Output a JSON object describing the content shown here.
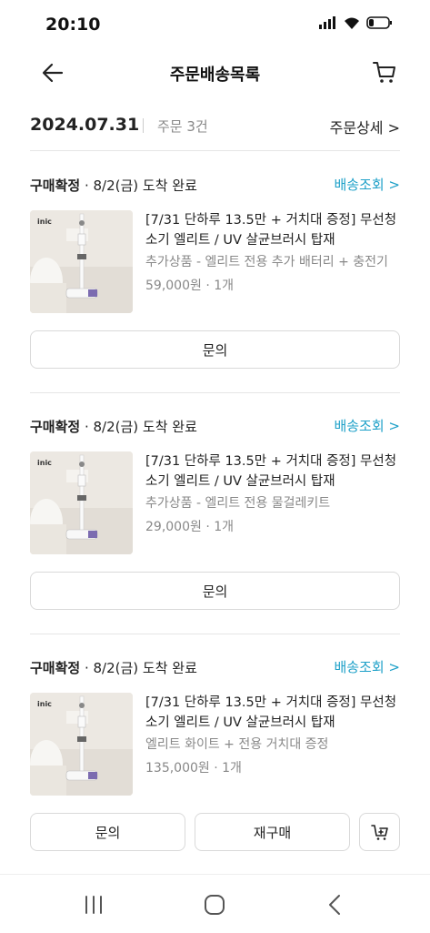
{
  "status_bar": {
    "time": "20:10"
  },
  "header": {
    "title": "주문배송목록"
  },
  "summary": {
    "date": "2024.07.31",
    "count": "주문 3건",
    "detail_link": "주문상세 >"
  },
  "orders": [
    {
      "status_bold": "구매확정",
      "status_rest": " · 8/2(금) 도착 완료",
      "track_label": "배송조회 >",
      "thumb_brand": "inic",
      "title": "[7/31 단하루 13.5만 + 거치대 증정] 무선청소기 엘리트 / UV 살균브러시 탑재",
      "option": "추가상품 - 엘리트 전용 추가 배터리 + 충전기",
      "price": "59,000원 · 1개",
      "buttons": [
        "문의"
      ]
    },
    {
      "status_bold": "구매확정",
      "status_rest": " · 8/2(금) 도착 완료",
      "track_label": "배송조회 >",
      "thumb_brand": "inic",
      "title": "[7/31 단하루 13.5만 + 거치대 증정] 무선청소기 엘리트 / UV 살균브러시 탑재",
      "option": "추가상품 - 엘리트 전용 물걸레키트",
      "price": "29,000원 · 1개",
      "buttons": [
        "문의"
      ]
    },
    {
      "status_bold": "구매확정",
      "status_rest": " · 8/2(금) 도착 완료",
      "track_label": "배송조회 >",
      "thumb_brand": "inic",
      "title": "[7/31 단하루 13.5만 + 거치대 증정] 무선청소기 엘리트 / UV 살균브러시 탑재",
      "option": "엘리트 화이트 + 전용 거치대 증정",
      "price": "135,000원 · 1개",
      "buttons": [
        "문의",
        "재구매"
      ]
    }
  ],
  "colors": {
    "accent": "#1ea0c8",
    "text": "#222222",
    "muted": "#888888",
    "border": "#d9d9d9"
  },
  "icons": [
    "back-arrow-icon",
    "cart-icon",
    "add-to-cart-icon",
    "recent-apps-icon",
    "home-icon",
    "nav-back-icon"
  ]
}
